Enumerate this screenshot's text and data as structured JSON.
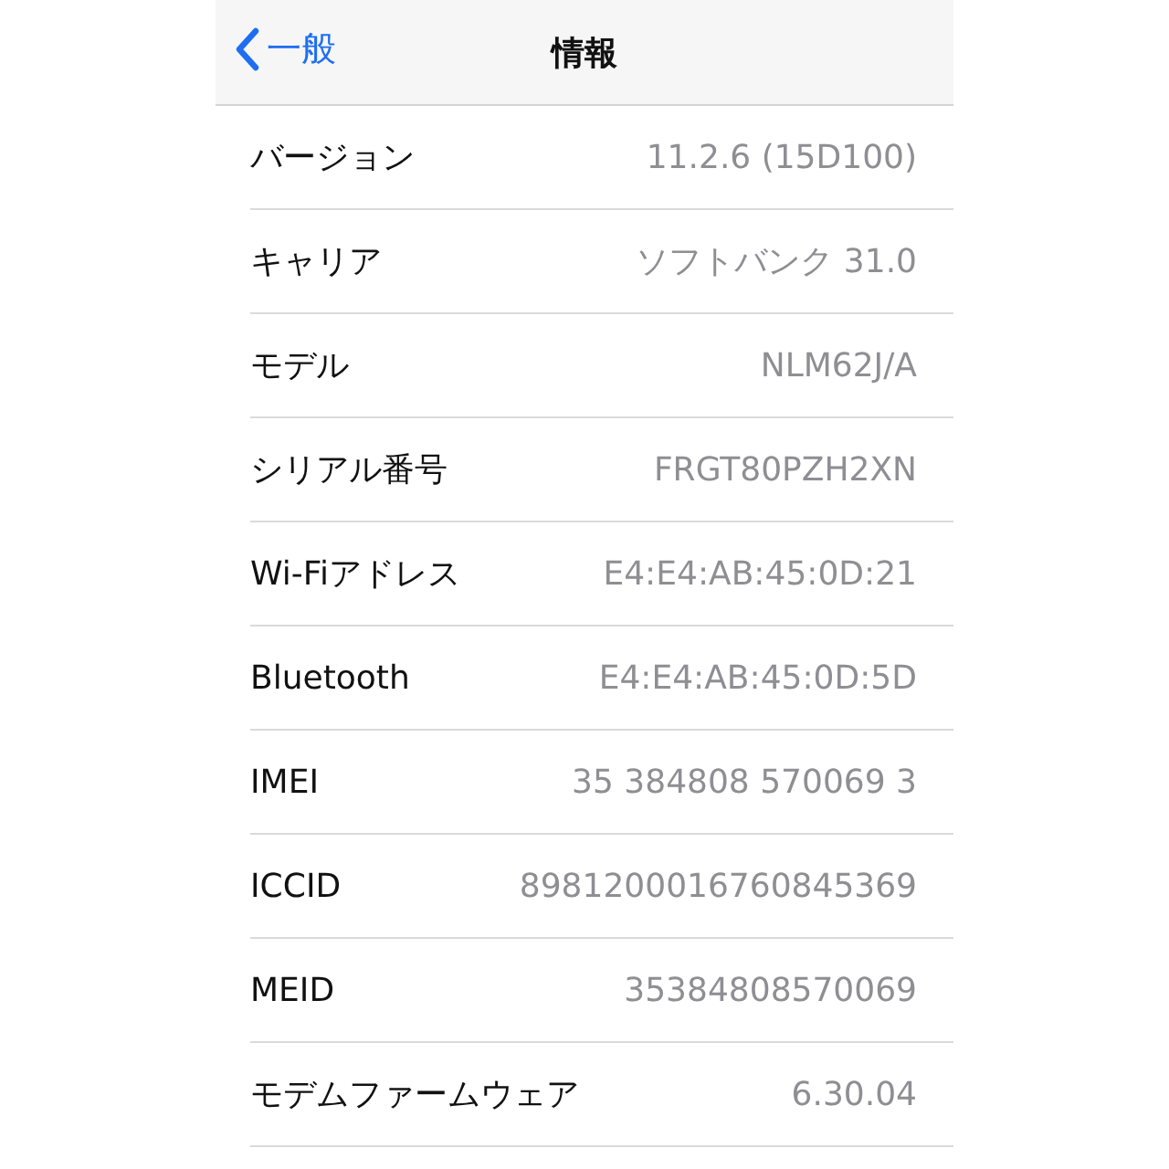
{
  "nav": {
    "back": "一般",
    "title": "情報"
  },
  "rows": [
    {
      "label": "バージョン",
      "value": "11.2.6 (15D100)"
    },
    {
      "label": "キャリア",
      "value": "ソフトバンク 31.0"
    },
    {
      "label": "モデル",
      "value": "NLM62J/A"
    },
    {
      "label": "シリアル番号",
      "value": "FRGT80PZH2XN"
    },
    {
      "label": "Wi-Fiアドレス",
      "value": "E4:E4:AB:45:0D:21"
    },
    {
      "label": "Bluetooth",
      "value": "E4:E4:AB:45:0D:5D"
    },
    {
      "label": "IMEI",
      "value": "35 384808 570069 3"
    },
    {
      "label": "ICCID",
      "value": "8981200016760845369"
    },
    {
      "label": "MEID",
      "value": "35384808570069"
    },
    {
      "label": "モデムファームウェア",
      "value": "6.30.04"
    }
  ]
}
